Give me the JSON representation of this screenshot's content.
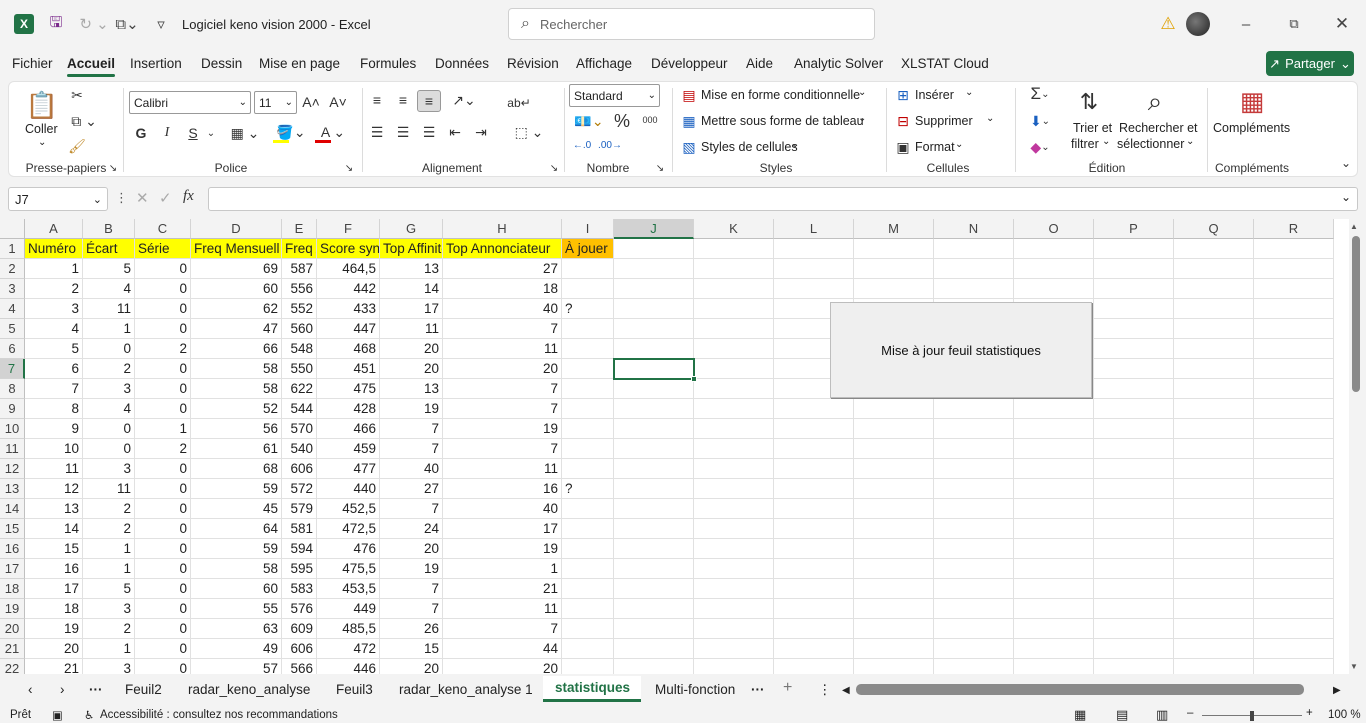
{
  "titlebar": {
    "file_title": "Logiciel keno vision 2000  -  Excel",
    "search_placeholder": "Rechercher"
  },
  "menu": {
    "items": [
      "Fichier",
      "Accueil",
      "Insertion",
      "Dessin",
      "Mise en page",
      "Formules",
      "Données",
      "Révision",
      "Affichage",
      "Développeur",
      "Aide",
      "Analytic Solver",
      "XLSTAT Cloud"
    ],
    "active": "Accueil",
    "share_label": "Partager"
  },
  "ribbon": {
    "clipboard": {
      "paste_label": "Coller",
      "group": "Presse-papiers"
    },
    "font": {
      "name": "Calibri",
      "size": "11",
      "bold": "G",
      "italic": "I",
      "underline": "S",
      "group": "Police"
    },
    "alignment": {
      "group": "Alignement"
    },
    "number": {
      "format": "Standard",
      "percent": "%",
      "thousands": "000",
      "group": "Nombre"
    },
    "styles": {
      "conditional": "Mise en forme conditionnelle",
      "table": "Mettre sous forme de tableau",
      "cell_styles": "Styles de cellules",
      "group": "Styles"
    },
    "cells": {
      "insert": "Insérer",
      "delete": "Supprimer",
      "format": "Format",
      "group": "Cellules"
    },
    "editing": {
      "sort_line1": "Trier et",
      "sort_line2": "filtrer",
      "find_line1": "Rechercher et",
      "find_line2": "sélectionner",
      "group": "Édition"
    },
    "addins": {
      "label": "Compléments",
      "group": "Compléments"
    }
  },
  "formula_bar": {
    "name_box": "J7",
    "formula": ""
  },
  "sheet": {
    "columns": [
      "A",
      "B",
      "C",
      "D",
      "E",
      "F",
      "G",
      "H",
      "I",
      "J",
      "K",
      "L",
      "M",
      "N",
      "O",
      "P",
      "Q",
      "R"
    ],
    "header_row": [
      "Numéro",
      "Écart",
      "Série",
      "Freq Mensuell",
      "Freq Annuelle",
      "Score synthétique",
      "Top Affinité",
      "Top Annonciateur",
      "À jouer"
    ],
    "rows": [
      [
        "1",
        "5",
        "0",
        "69",
        "587",
        "464,5",
        "13",
        "27",
        ""
      ],
      [
        "2",
        "4",
        "0",
        "60",
        "556",
        "442",
        "14",
        "18",
        ""
      ],
      [
        "3",
        "11",
        "0",
        "62",
        "552",
        "433",
        "17",
        "40",
        "?"
      ],
      [
        "4",
        "1",
        "0",
        "47",
        "560",
        "447",
        "11",
        "7",
        ""
      ],
      [
        "5",
        "0",
        "2",
        "66",
        "548",
        "468",
        "20",
        "11",
        ""
      ],
      [
        "6",
        "2",
        "0",
        "58",
        "550",
        "451",
        "20",
        "20",
        ""
      ],
      [
        "7",
        "3",
        "0",
        "58",
        "622",
        "475",
        "13",
        "7",
        ""
      ],
      [
        "8",
        "4",
        "0",
        "52",
        "544",
        "428",
        "19",
        "7",
        ""
      ],
      [
        "9",
        "0",
        "1",
        "56",
        "570",
        "466",
        "7",
        "19",
        ""
      ],
      [
        "10",
        "0",
        "2",
        "61",
        "540",
        "459",
        "7",
        "7",
        ""
      ],
      [
        "11",
        "3",
        "0",
        "68",
        "606",
        "477",
        "40",
        "11",
        ""
      ],
      [
        "12",
        "11",
        "0",
        "59",
        "572",
        "440",
        "27",
        "16",
        "?"
      ],
      [
        "13",
        "2",
        "0",
        "45",
        "579",
        "452,5",
        "7",
        "40",
        ""
      ],
      [
        "14",
        "2",
        "0",
        "64",
        "581",
        "472,5",
        "24",
        "17",
        ""
      ],
      [
        "15",
        "1",
        "0",
        "59",
        "594",
        "476",
        "20",
        "19",
        ""
      ],
      [
        "16",
        "1",
        "0",
        "58",
        "595",
        "475,5",
        "19",
        "1",
        ""
      ],
      [
        "17",
        "5",
        "0",
        "60",
        "583",
        "453,5",
        "7",
        "21",
        ""
      ],
      [
        "18",
        "3",
        "0",
        "55",
        "576",
        "449",
        "7",
        "11",
        ""
      ],
      [
        "19",
        "2",
        "0",
        "63",
        "609",
        "485,5",
        "26",
        "7",
        ""
      ],
      [
        "20",
        "1",
        "0",
        "49",
        "606",
        "472",
        "15",
        "44",
        ""
      ],
      [
        "21",
        "3",
        "0",
        "57",
        "566",
        "446",
        "20",
        "20",
        ""
      ]
    ],
    "macro_button": "Mise à jour feuil statistiques"
  },
  "tabs": {
    "items": [
      "Feuil2",
      "radar_keno_analyse",
      "Feuil3",
      "radar_keno_analyse 1",
      "statistiques",
      "Multi-fonction"
    ],
    "active": "statistiques",
    "more": "···"
  },
  "status": {
    "ready": "Prêt",
    "accessibility": "Accessibilité : consultez nos recommandations",
    "zoom": "100 %"
  },
  "colors": {
    "accent": "#217346",
    "header_yellow": "#ffff00",
    "header_orange": "#ffc000"
  }
}
